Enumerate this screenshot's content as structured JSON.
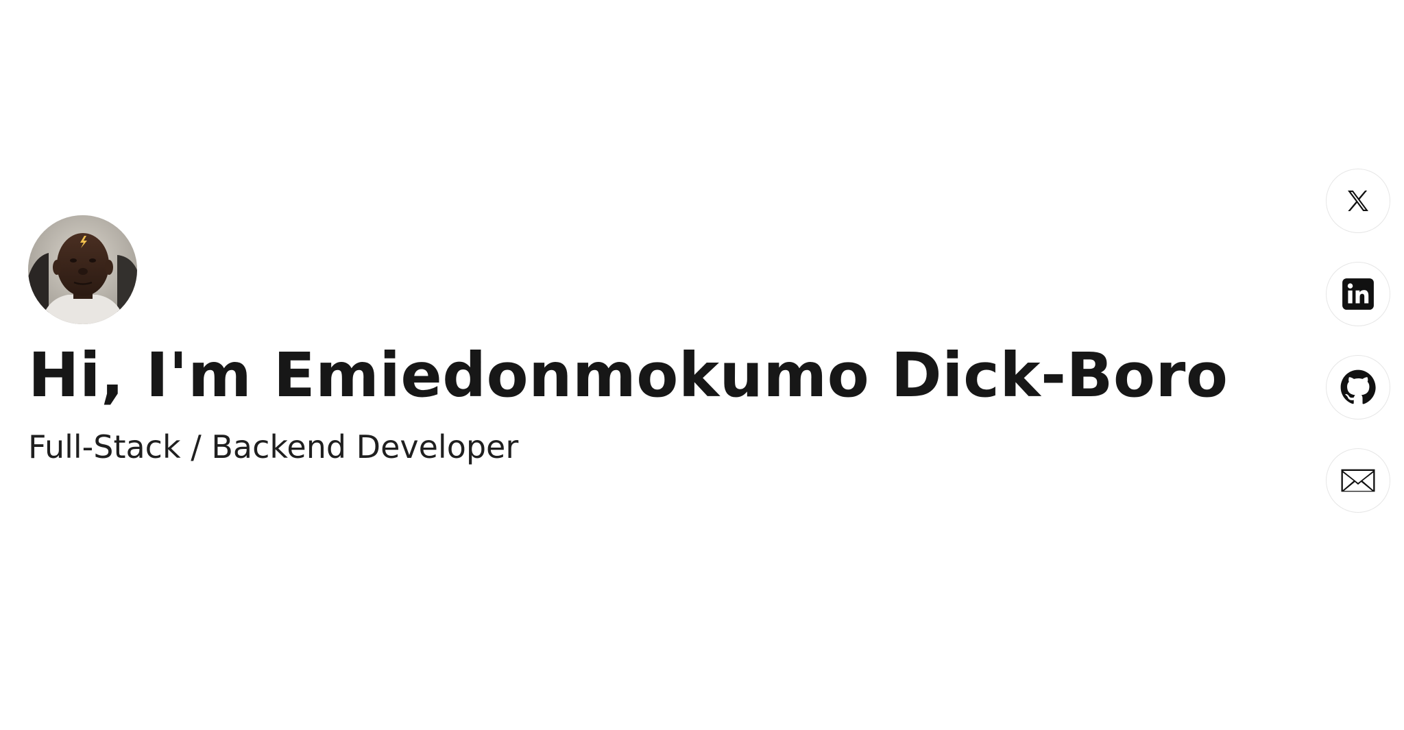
{
  "hero": {
    "avatar_alt": "Profile photo",
    "headline": "Hi, I'm Emiedonmokumo Dick-Boro",
    "subtitle": "Full-Stack / Backend Developer"
  },
  "social": {
    "items": [
      {
        "name": "X",
        "icon": "x-icon"
      },
      {
        "name": "LinkedIn",
        "icon": "linkedin-icon"
      },
      {
        "name": "GitHub",
        "icon": "github-icon"
      },
      {
        "name": "Email",
        "icon": "mail-icon"
      }
    ]
  },
  "colors": {
    "text": "#171717",
    "background": "#ffffff",
    "icon_border": "#e6e6e6",
    "icon": "#111111"
  }
}
